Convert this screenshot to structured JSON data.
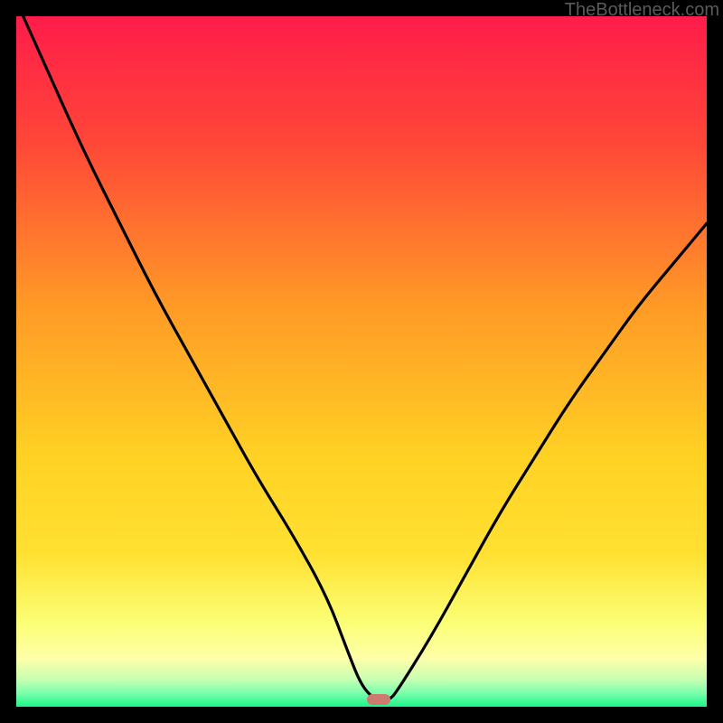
{
  "attribution": "TheBottleneck.com",
  "colors": {
    "top": "#ff1c4a",
    "yellow": "#ffe132",
    "pale_yellow": "#feffa8",
    "green": "#1bf58a",
    "curve": "#000000",
    "marker": "#cf7a6f",
    "background": "#000000"
  },
  "chart_data": {
    "type": "line",
    "title": "",
    "xlabel": "",
    "ylabel": "",
    "xlim": [
      0,
      100
    ],
    "ylim": [
      0,
      100
    ],
    "grid": false,
    "legend": false,
    "series": [
      {
        "name": "bottleneck-curve",
        "x": [
          1,
          5,
          10,
          15,
          20,
          25,
          30,
          35,
          40,
          45,
          48,
          50,
          52,
          53,
          54,
          55,
          60,
          65,
          70,
          75,
          80,
          85,
          90,
          95,
          100
        ],
        "y": [
          100,
          91,
          80,
          70,
          60,
          51,
          42,
          33,
          25,
          16,
          8,
          3,
          1,
          1,
          1,
          2,
          10,
          19,
          28,
          36,
          44,
          51,
          58,
          64,
          70
        ]
      }
    ],
    "annotations": [
      {
        "name": "min-marker",
        "x": 52.5,
        "y": 1
      }
    ]
  }
}
